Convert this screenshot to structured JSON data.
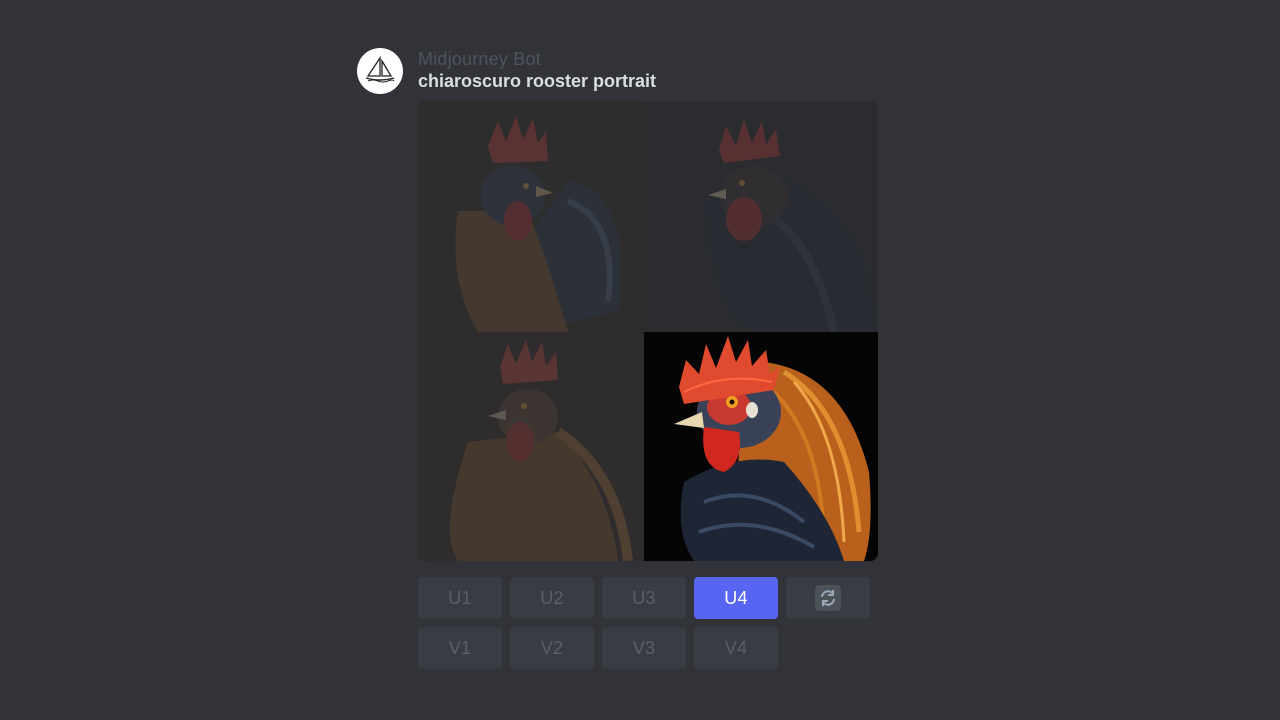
{
  "message": {
    "author": "Midjourney Bot",
    "prompt": "chiaroscuro rooster portrait"
  },
  "image_grid": {
    "tiles": [
      {
        "label": "image-1",
        "selected": false
      },
      {
        "label": "image-2",
        "selected": false
      },
      {
        "label": "image-3",
        "selected": false
      },
      {
        "label": "image-4",
        "selected": true
      }
    ]
  },
  "buttons": {
    "upscale": [
      "U1",
      "U2",
      "U3",
      "U4"
    ],
    "variation": [
      "V1",
      "V2",
      "V3",
      "V4"
    ],
    "active": "U4",
    "reroll_icon": "reroll-icon"
  },
  "colors": {
    "background": "#313338",
    "button": "#393c43",
    "button_active": "#5865f2"
  }
}
